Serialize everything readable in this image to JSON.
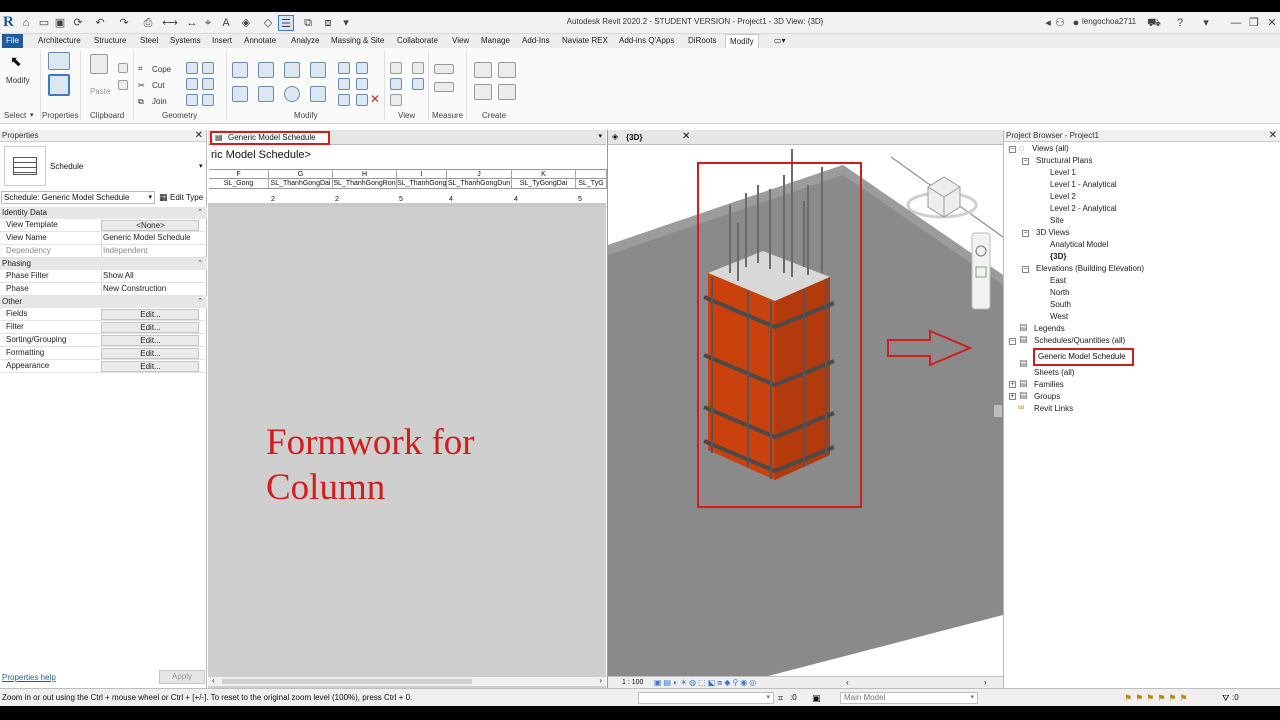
{
  "window": {
    "title": "Autodesk Revit 2020.2 - STUDENT VERSION - Project1 - 3D View: {3D}",
    "app_letter": "R",
    "user": "lengochoa2711",
    "help": "?"
  },
  "ribbon_tabs": [
    "File",
    "Architecture",
    "Structure",
    "Steel",
    "Systems",
    "Insert",
    "Annotate",
    "Analyze",
    "Massing & Site",
    "Collaborate",
    "View",
    "Manage",
    "Add-Ins",
    "Naviate REX",
    "Add-ins Q'Apps",
    "DiRoots",
    "Modify"
  ],
  "ribbon": {
    "modify_label": "Modify",
    "paste_label": "Paste",
    "cope_label": "Cope",
    "cut_label": "Cut",
    "join_label": "Join",
    "panels": [
      "Select",
      "Properties",
      "Clipboard",
      "Geometry",
      "Modify",
      "View",
      "Measure",
      "Create"
    ]
  },
  "properties": {
    "title": "Properties",
    "type_name": "Schedule",
    "selector": "Schedule: Generic Model Schedule",
    "edit_type": "Edit Type",
    "sections": {
      "identity": "Identity Data",
      "phasing": "Phasing",
      "other": "Other"
    },
    "rows": {
      "view_template": {
        "k": "View Template",
        "v": "<None>"
      },
      "view_name": {
        "k": "View Name",
        "v": "Generic Model Schedule"
      },
      "dependency": {
        "k": "Dependency",
        "v": "Independent"
      },
      "phase_filter": {
        "k": "Phase Filter",
        "v": "Show All"
      },
      "phase": {
        "k": "Phase",
        "v": "New Construction"
      },
      "fields": {
        "k": "Fields",
        "v": "Edit..."
      },
      "filter": {
        "k": "Filter",
        "v": "Edit..."
      },
      "sorting": {
        "k": "Sorting/Grouping",
        "v": "Edit..."
      },
      "formatting": {
        "k": "Formatting",
        "v": "Edit..."
      },
      "appearance": {
        "k": "Appearance",
        "v": "Edit..."
      }
    },
    "help_link": "Properties help",
    "apply": "Apply"
  },
  "schedule": {
    "tab_label": "Generic Model Schedule",
    "title": "ric Model Schedule>",
    "columns": [
      {
        "letter": "F",
        "name": "SL_Gong",
        "value": ""
      },
      {
        "letter": "G",
        "name": "SL_ThanhGongDai",
        "value": "2"
      },
      {
        "letter": "H",
        "name": "SL_ThanhGongRon",
        "value": "2"
      },
      {
        "letter": "I",
        "name": "SL_ThanhGong",
        "value": "5"
      },
      {
        "letter": "J",
        "name": "SL_ThanhGongDun",
        "value": "4"
      },
      {
        "letter": "K",
        "name": "SL_TyGongDai",
        "value": "4"
      },
      {
        "letter": "",
        "name": "SL_TyG",
        "value": "5"
      }
    ],
    "annotation": [
      "Formwork for",
      "Column"
    ]
  },
  "view3d": {
    "tab_label": "{3D}",
    "scale": "1 : 100"
  },
  "browser": {
    "title": "Project Browser - Project1",
    "nodes": {
      "views": "Views (all)",
      "structural_plans": "Structural Plans",
      "level1": "Level 1",
      "level1a": "Level 1 - Analytical",
      "level2": "Level 2",
      "level2a": "Level 2 - Analytical",
      "site": "Site",
      "views3d": "3D Views",
      "analytical_model": "Analytical Model",
      "view3d": "{3D}",
      "elevations": "Elevations (Building Elevation)",
      "east": "East",
      "north": "North",
      "south": "South",
      "west": "West",
      "legends": "Legends",
      "schedules": "Schedules/Quantities (all)",
      "generic_schedule": "Generic Model Schedule",
      "sheets": "Sheets (all)",
      "families": "Families",
      "groups": "Groups",
      "revit_links": "Revit Links"
    }
  },
  "status": {
    "message": "Zoom in or out using the Ctrl + mouse wheel or Ctrl + [+/-]. To reset to the original zoom level (100%), press Ctrl + 0.",
    "selection_count": ":0",
    "model": "Main Model",
    "filter_count": ":0"
  },
  "colors": {
    "annotation_red": "#d11d1d",
    "file_tab": "#1f5c9e",
    "formwork_orange": "#c9420e"
  }
}
